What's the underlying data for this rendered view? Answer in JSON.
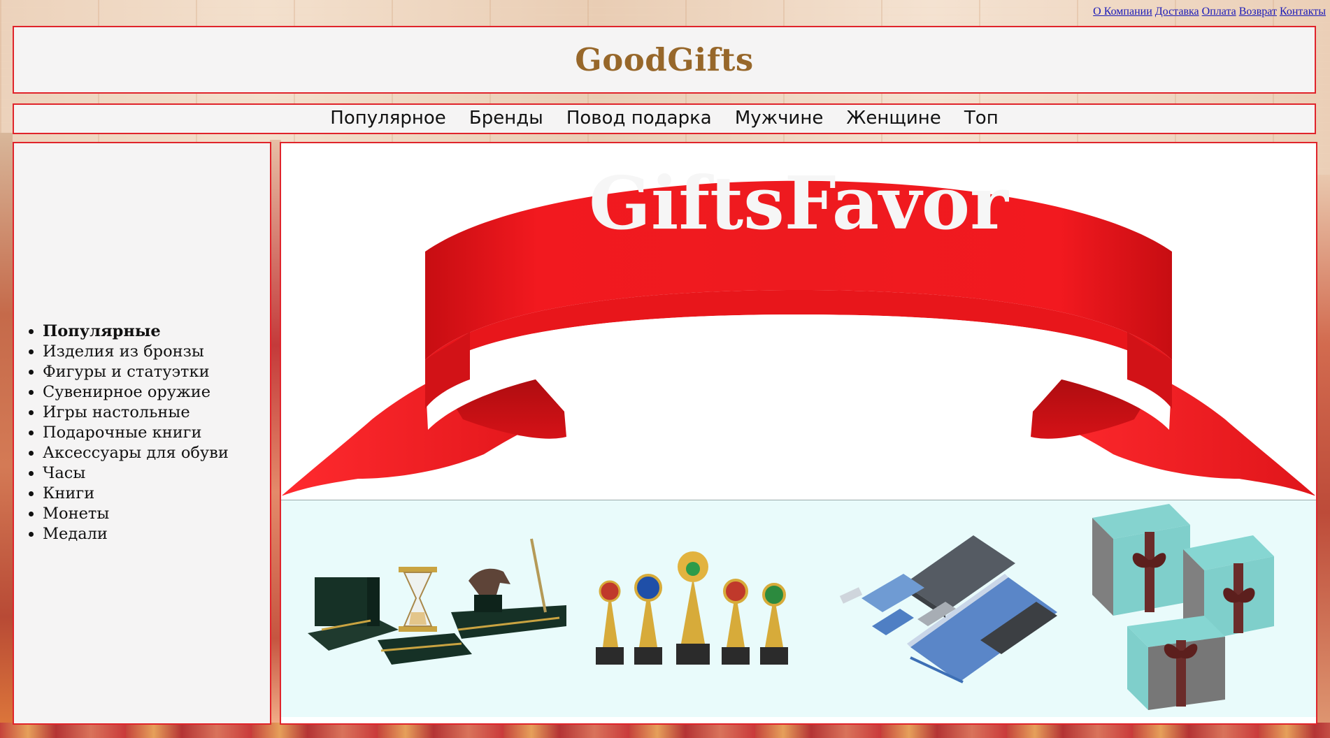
{
  "top_links": [
    "О Компании",
    "Доставка",
    "Оплата",
    "Возврат",
    "Контакты"
  ],
  "header": {
    "title": "GoodGifts"
  },
  "nav": {
    "items": [
      "Популярное",
      "Бренды",
      "Повод подарка",
      "Мужчине",
      "Женщине",
      "Топ"
    ]
  },
  "sidebar": {
    "items": [
      "Популярные",
      "Изделия из бронзы",
      "Фигуры и статуэтки",
      "Сувенирное оружие",
      "Игры настольные",
      "Подарочные книги",
      "Аксессуары для обуви",
      "Часы",
      "Книги",
      "Монеты",
      "Медали"
    ],
    "active_index": 0
  },
  "banner": {
    "text": "GiftsFavor",
    "ribbon_color": "#e8161b"
  },
  "products": {
    "images": [
      "desk-set-image",
      "trophies-image",
      "stationery-set-image",
      "gift-boxes-image"
    ]
  },
  "colors": {
    "border": "#e0242b",
    "title": "#97672a",
    "panel": "#f5f4f4",
    "products_bg": "#e9fbfb",
    "link": "#1a1ab8"
  }
}
